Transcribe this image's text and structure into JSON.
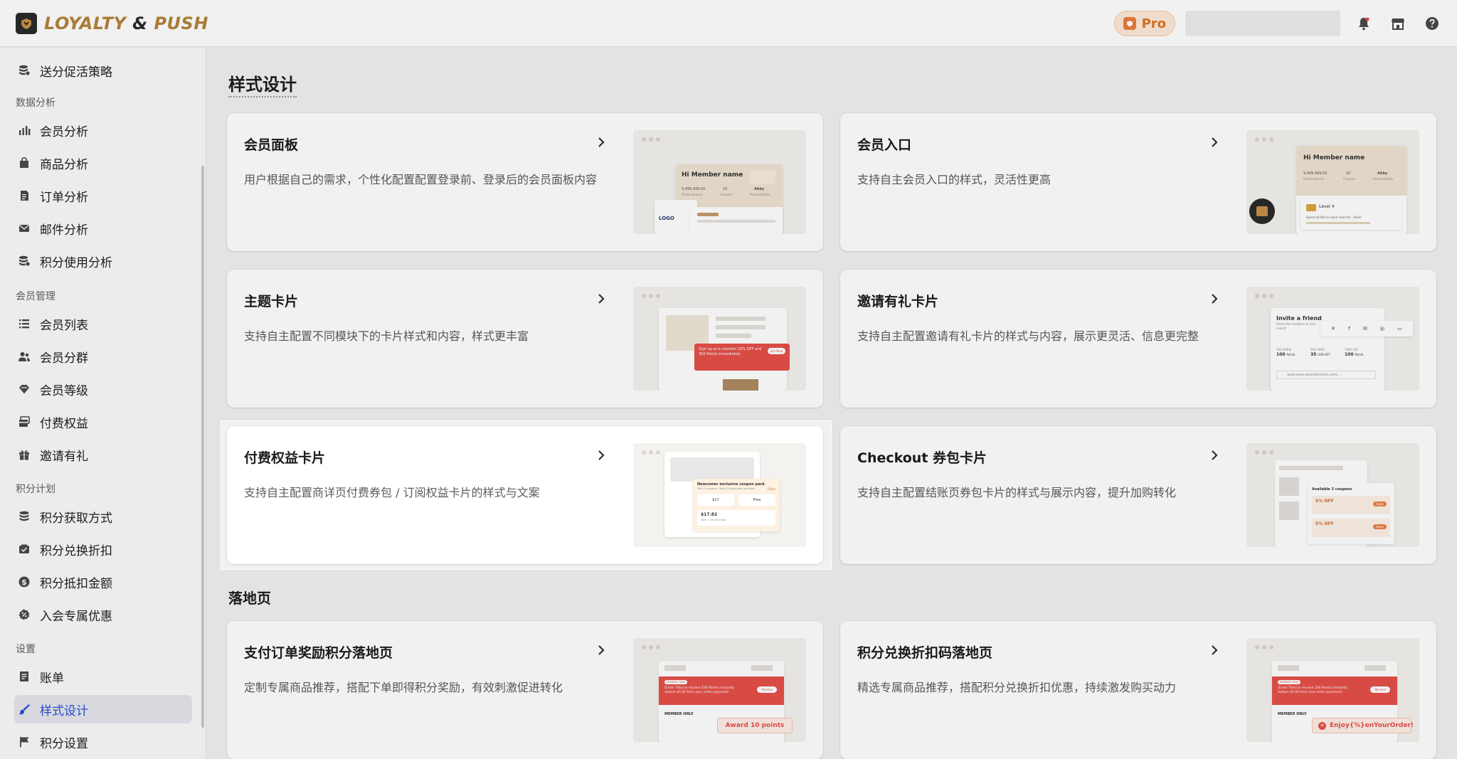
{
  "header": {
    "logo_main": "LOYALTY",
    "logo_amp": " & ",
    "logo_end": "PUSH",
    "pro_label": "Pro"
  },
  "sidebar": {
    "items": [
      {
        "label": "送分促活策略",
        "icon": "coins-stack-icon"
      },
      {
        "group": "数据分析"
      },
      {
        "label": "会员分析",
        "icon": "bar-chart-icon"
      },
      {
        "label": "商品分析",
        "icon": "shopping-bag-icon"
      },
      {
        "label": "订单分析",
        "icon": "document-icon"
      },
      {
        "label": "邮件分析",
        "icon": "mail-icon"
      },
      {
        "label": "积分使用分析",
        "icon": "coins-stack-icon"
      },
      {
        "group": "会员管理"
      },
      {
        "label": "会员列表",
        "icon": "list-icon"
      },
      {
        "label": "会员分群",
        "icon": "users-icon"
      },
      {
        "label": "会员等级",
        "icon": "diamond-icon"
      },
      {
        "label": "付费权益",
        "icon": "card-stack-icon"
      },
      {
        "label": "邀请有礼",
        "icon": "gift-icon"
      },
      {
        "group": "积分计划"
      },
      {
        "label": "积分获取方式",
        "icon": "coins-stack-icon"
      },
      {
        "label": "积分兑换折扣",
        "icon": "ticket-icon"
      },
      {
        "label": "积分抵扣金额",
        "icon": "dollar-circle-icon"
      },
      {
        "label": "入会专属优惠",
        "icon": "percent-badge-icon"
      },
      {
        "group": "设置"
      },
      {
        "label": "账单",
        "icon": "receipt-icon"
      },
      {
        "label": "样式设计",
        "icon": "paint-brush-icon",
        "active": true
      },
      {
        "label": "积分设置",
        "icon": "flag-icon"
      }
    ]
  },
  "main": {
    "page_title": "样式设计",
    "section_landing": "落地页",
    "cards": [
      {
        "title": "会员面板",
        "desc": "用户根据自己的需求，个性化配置配置登录前、登录后的会员面板内容"
      },
      {
        "title": "会员入口",
        "desc": "支持自主会员入口的样式，灵活性更高"
      },
      {
        "title": "主题卡片",
        "desc": "支持自主配置不同模块下的卡片样式和内容，样式更丰富"
      },
      {
        "title": "邀请有礼卡片",
        "desc": "支持自主配置邀请有礼卡片的样式与内容，展示更灵活、信息更完整"
      },
      {
        "title": "付费权益卡片",
        "desc": "支持自主配置商详页付费券包 / 订阅权益卡片的样式与文案"
      },
      {
        "title": "Checkout 券包卡片",
        "desc": "支持自主配置结账页券包卡片的样式与展示内容，提升加购转化"
      },
      {
        "title": "支付订单奖励积分落地页",
        "desc": "定制专属商品推荐，搭配下单即得积分奖励，有效刺激促进转化"
      },
      {
        "title": "积分兑换折扣码落地页",
        "desc": "精选专属商品推荐，搭配积分兑换折扣优惠，持续激发购买动力"
      }
    ],
    "previews": {
      "member_panel": {
        "hi": "Hi Member name",
        "points": "9,999,999.00",
        "coupons": "10",
        "name": "Abby",
        "pts_label": "Points balance",
        "cp_label": "Coupons",
        "rw_label": "Personal Data",
        "logo": "LOGO"
      },
      "member_entry": {
        "hi": "Hi Member name",
        "points": "9,999,999.00",
        "coupons": "10",
        "name": "Abby",
        "pts_label": "Points balance",
        "cp_label": "Coupons",
        "rw_label": "Personal Data",
        "level": "Level 4",
        "progress_text": "Spend $1000 to reach next tier : Silver"
      },
      "theme_card": {
        "promo": "Sign up as a member 20% OFF and 300 Points immediately",
        "btn": "Join Now"
      },
      "invite": {
        "title": "Invite a friend",
        "sub": "Share this invitation to earn reward",
        "you_earn": "YOU EARN",
        "you_save": "YOU SAVE",
        "they_get": "THEY GET",
        "v1": "100",
        "v1u": "Points",
        "v2": "35",
        "v2u": "USD OFF",
        "v3": "100",
        "v3u": "Points",
        "link": "rpviw-seven.com/referral?ref=xmm..."
      },
      "paid_benefit": {
        "header": "Newcomer exclusive coupon pack",
        "sub": "Get 11 coupons · Valid 30 days after purchase",
        "btn": "Claim",
        "p1": "$17",
        "p2": "Free",
        "price": "$17.82",
        "price_sub": "View + full Purchase"
      },
      "checkout": {
        "title": "Available 3 coupons",
        "c1": "5% OFF",
        "c2": "5% OFF",
        "btn": "Apply"
      },
      "landing1": {
        "tag": "PAYMENT ONLY",
        "text": "[Enter Title] to receive 100 Points (instantly deduct $5.00 from your order payment)",
        "btn": "Receive",
        "member": "MEMBER ONLY",
        "award": "Award 10 points"
      },
      "landing2": {
        "tag": "PAYMENT ONLY",
        "text": "[Enter Title] to receive 100 Points (instantly deduct $5.00 from your order payment)",
        "btn": "Receive",
        "member": "MEMBER ONLY",
        "enjoy": "Enjoy{%}onYourOrder!"
      }
    }
  },
  "colors": {
    "brand_gold": "#b3833a",
    "active_blue": "#2b4fd6",
    "pro_orange": "#e0741f",
    "preview_red": "#e5504a"
  }
}
